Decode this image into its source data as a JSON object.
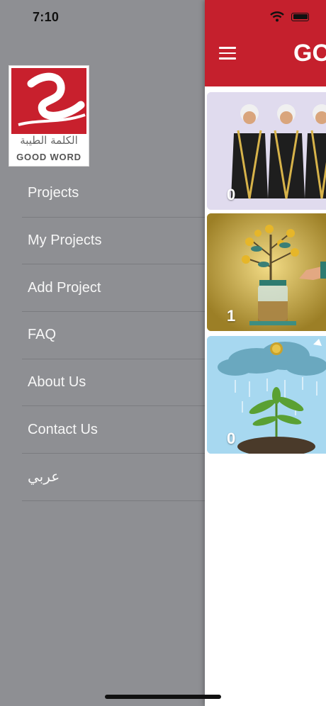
{
  "status_bar": {
    "time": "7:10"
  },
  "logo": {
    "arabic_text": "الكلمة الطيبة",
    "english_text": "GOOD WORD"
  },
  "drawer": {
    "menu_items": [
      {
        "label": "Projects"
      },
      {
        "label": "My Projects"
      },
      {
        "label": "Add Project"
      },
      {
        "label": "FAQ"
      },
      {
        "label": "About Us"
      },
      {
        "label": "Contact Us"
      },
      {
        "label": "عربي"
      }
    ]
  },
  "header": {
    "title": "GO",
    "menu_icon": "hamburger-menu-icon"
  },
  "projects": [
    {
      "count": "0",
      "image": "men-in-traditional-robes"
    },
    {
      "count": "1",
      "image": "money-tree-jar"
    },
    {
      "count": "0",
      "image": "plant-in-rain"
    }
  ],
  "colors": {
    "brand_red": "#c5202d",
    "drawer_gray": "#8e8f93"
  }
}
